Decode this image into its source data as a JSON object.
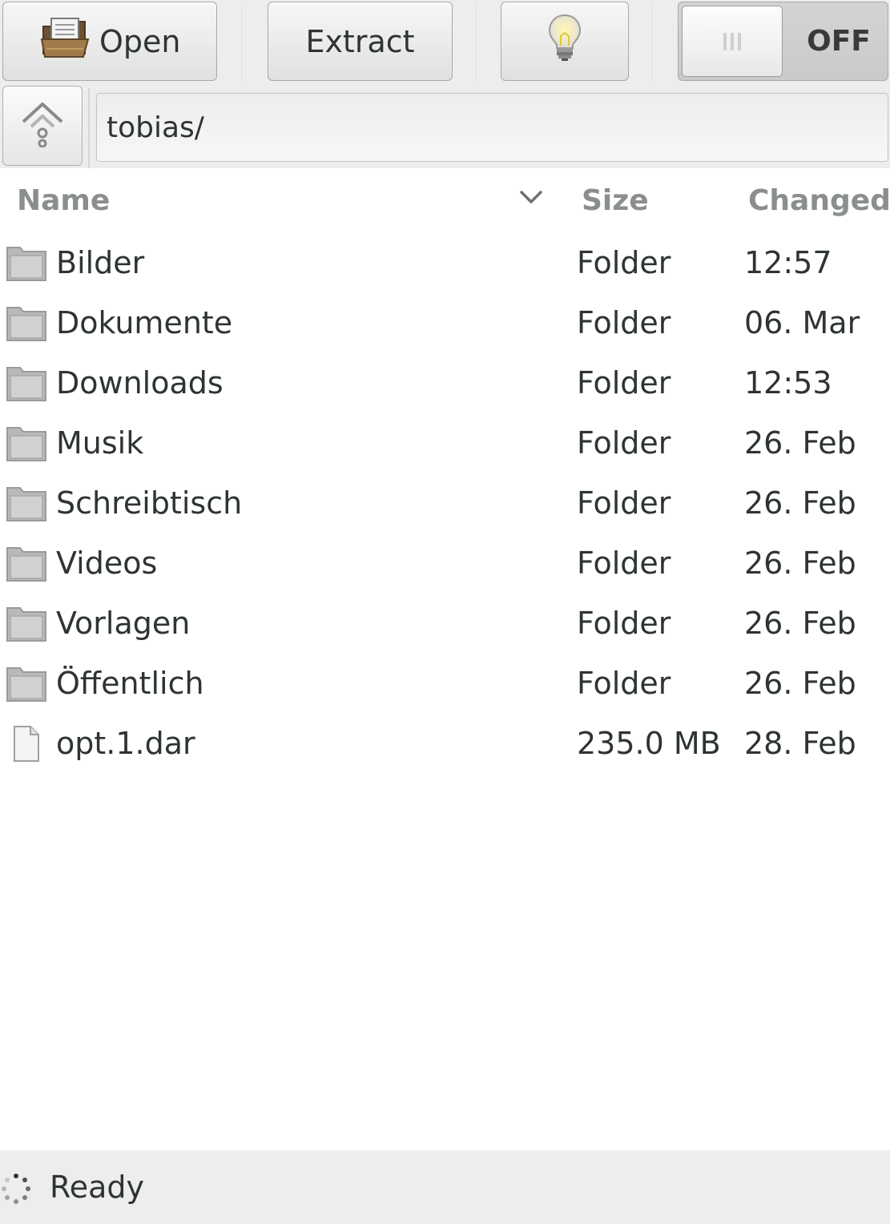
{
  "toolbar": {
    "open_label": "Open",
    "extract_label": "Extract",
    "switch_state": "OFF"
  },
  "location": {
    "path": "tobias/"
  },
  "columns": {
    "name": "Name",
    "size": "Size",
    "changed": "Changed"
  },
  "files": [
    {
      "name": "Bilder",
      "size": "Folder",
      "changed": "12:57",
      "type": "folder"
    },
    {
      "name": "Dokumente",
      "size": "Folder",
      "changed": "06. Mar",
      "type": "folder"
    },
    {
      "name": "Downloads",
      "size": "Folder",
      "changed": "12:53",
      "type": "folder"
    },
    {
      "name": "Musik",
      "size": "Folder",
      "changed": "26. Feb",
      "type": "folder"
    },
    {
      "name": "Schreibtisch",
      "size": "Folder",
      "changed": "26. Feb",
      "type": "folder"
    },
    {
      "name": "Videos",
      "size": "Folder",
      "changed": "26. Feb",
      "type": "folder"
    },
    {
      "name": "Vorlagen",
      "size": "Folder",
      "changed": "26. Feb",
      "type": "folder"
    },
    {
      "name": "Öffentlich",
      "size": "Folder",
      "changed": "26. Feb",
      "type": "folder"
    },
    {
      "name": "opt.1.dar",
      "size": "235.0 MB",
      "changed": "28. Feb",
      "type": "file"
    }
  ],
  "status": {
    "text": "Ready"
  },
  "colors": {
    "toolbar_bg": "#ededed",
    "header_text": "#8b8e8f",
    "folder_icon": "#bdbdbd"
  }
}
